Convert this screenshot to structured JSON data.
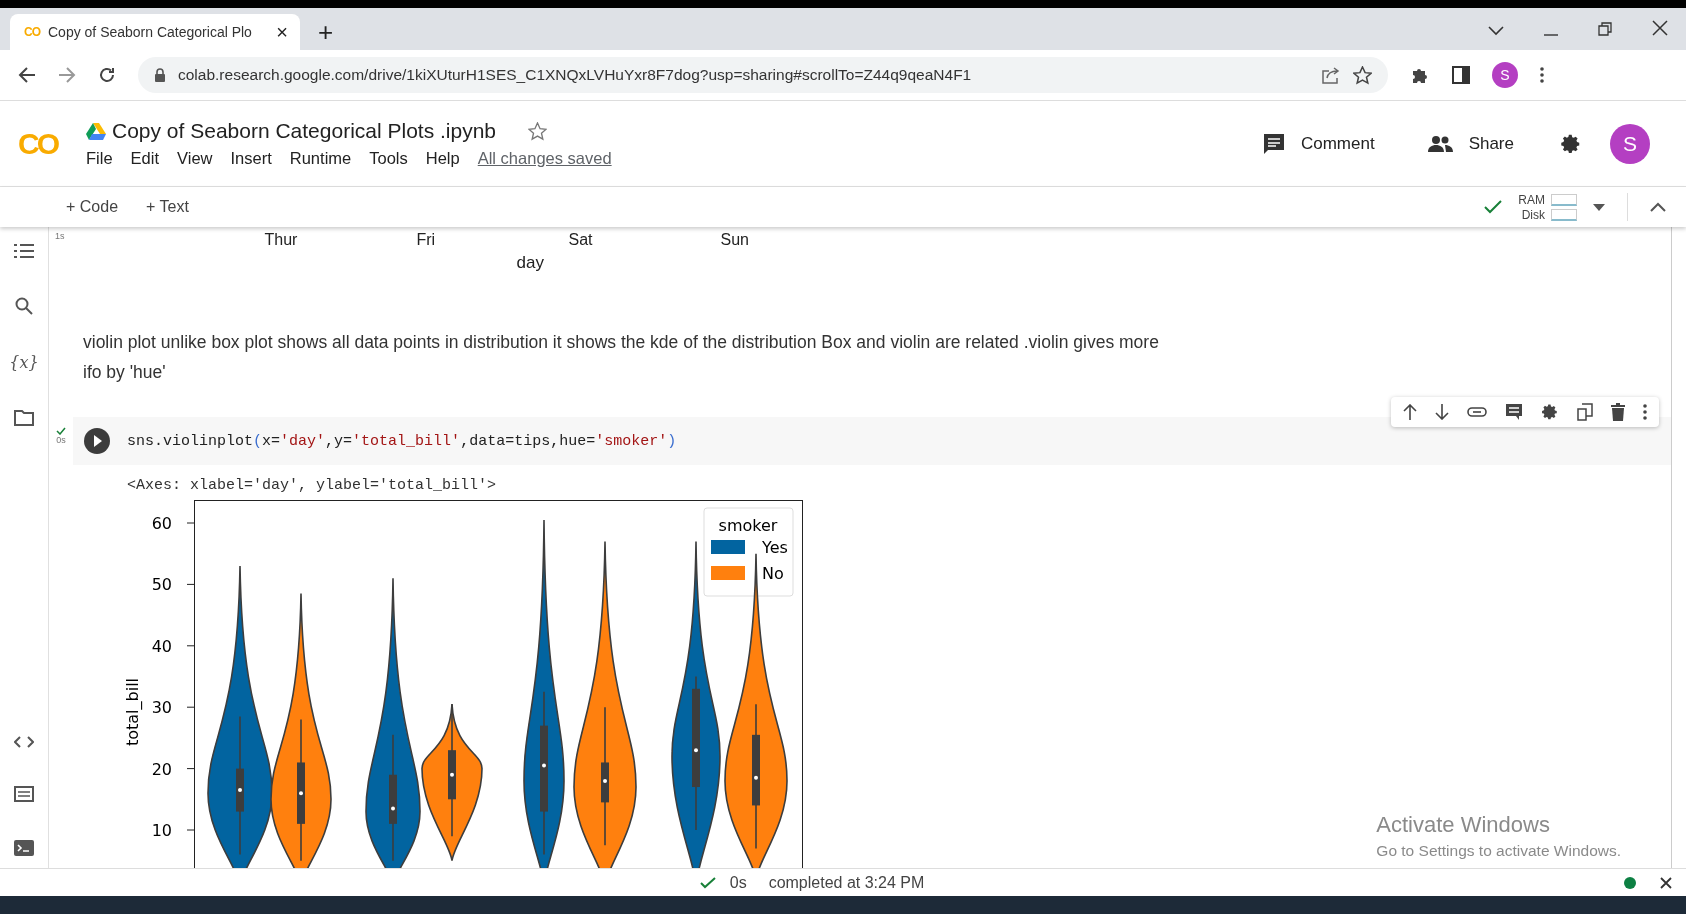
{
  "browser": {
    "tab_logo": "CO",
    "tab_title": "Copy of Seaborn Categorical Plo",
    "tab_close": "×",
    "new_tab": "+",
    "url": "colab.research.google.com/drive/1kiXUturH1SES_C1XNQxLVHuYxr8F7dog?usp=sharing#scrollTo=Z44q9qeaN4F1",
    "profile_initial": "S"
  },
  "colab": {
    "logo": "CO",
    "notebook_title": "Copy of Seaborn Categorical Plots .ipynb",
    "menu": [
      "File",
      "Edit",
      "View",
      "Insert",
      "Runtime",
      "Tools",
      "Help"
    ],
    "save_status": "All changes saved",
    "comment": "Comment",
    "share": "Share",
    "avatar_initial": "S"
  },
  "toolbar": {
    "add_code": "+ Code",
    "add_text": "+ Text",
    "ram": "RAM",
    "disk": "Disk"
  },
  "sidebar": {
    "variables_label": "{x}"
  },
  "previous_output": {
    "run_time": "1s",
    "xtick_labels": [
      "Thur",
      "Fri",
      "Sat",
      "Sun"
    ],
    "xlabel": "day"
  },
  "text_cell": "violin plot unlike box plot shows all data points in distribution it shows the kde of the distribution Box and violin are related .violin gives more ifo by 'hue'",
  "code_cell": {
    "run_time": "0s",
    "tokens": [
      {
        "text": "sns.violinplot",
        "kind": "plain"
      },
      {
        "text": "(",
        "kind": "paren"
      },
      {
        "text": "x=",
        "kind": "plain"
      },
      {
        "text": "'day'",
        "kind": "string"
      },
      {
        "text": ",y=",
        "kind": "plain"
      },
      {
        "text": "'total_bill'",
        "kind": "string"
      },
      {
        "text": ",data=tips,hue=",
        "kind": "plain"
      },
      {
        "text": "'smoker'",
        "kind": "string"
      },
      {
        "text": ")",
        "kind": "paren"
      }
    ],
    "output_text": "<Axes: xlabel='day', ylabel='total_bill'>"
  },
  "plot": {
    "ylabel": "total_bill",
    "yticks": [
      "60",
      "50",
      "40",
      "30",
      "20",
      "10"
    ],
    "legend": {
      "title": "smoker",
      "entries": [
        {
          "label": "Yes",
          "color": "#0264a0"
        },
        {
          "label": "No",
          "color": "#ff800e"
        }
      ]
    }
  },
  "status_bar": {
    "duration": "0s",
    "message": "completed at 3:24 PM"
  },
  "os_notice": {
    "title": "Activate Windows",
    "subtitle": "Go to Settings to activate Windows."
  }
}
